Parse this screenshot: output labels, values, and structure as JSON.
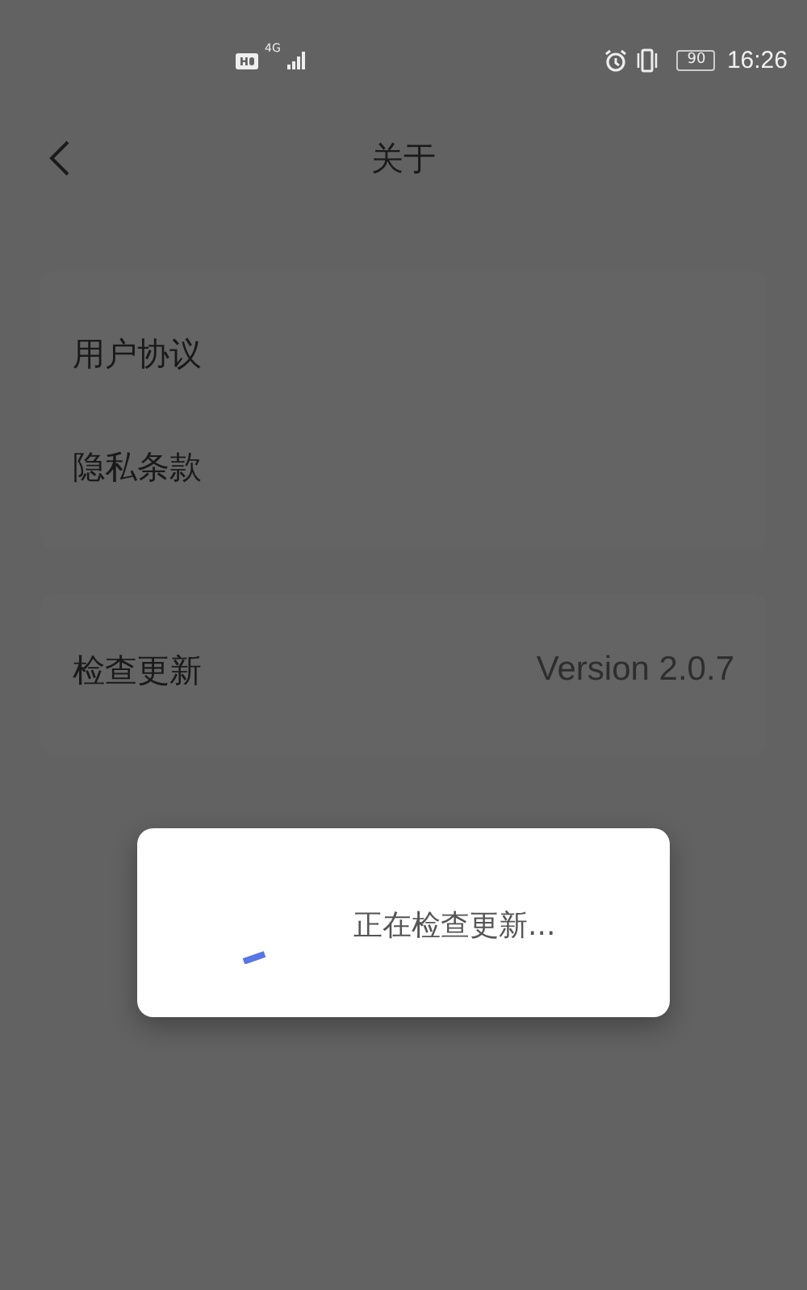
{
  "status_bar": {
    "network": "4G",
    "battery": "90",
    "time": "16:26"
  },
  "header": {
    "title": "关于"
  },
  "groups": [
    {
      "items": [
        {
          "label": "用户协议"
        },
        {
          "label": "隐私条款"
        }
      ]
    },
    {
      "items": [
        {
          "label": "检查更新",
          "value": "Version 2.0.7"
        }
      ]
    }
  ],
  "dialog": {
    "message": "正在检查更新..."
  }
}
